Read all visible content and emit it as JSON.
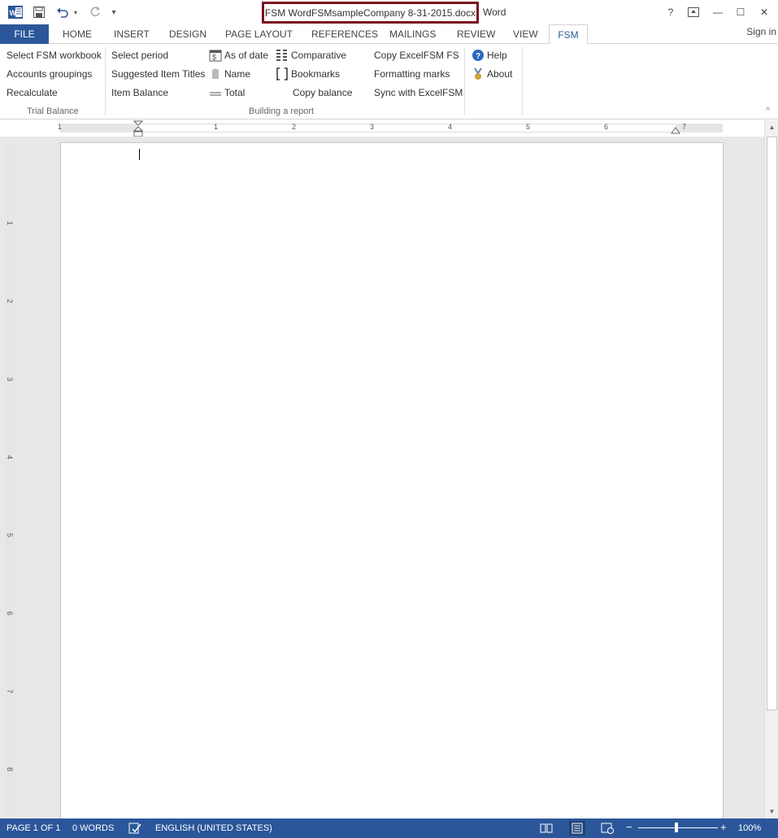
{
  "titlebar": {
    "document_name": "FSM WordFSMsampleCompany 8-31-2015.docx",
    "app_name": "Word",
    "help_glyph": "?",
    "restore_ribbon_glyph": "⇱",
    "minimize_glyph": "—",
    "maximize_glyph": "☐",
    "close_glyph": "✕",
    "customize_glyph": "▾"
  },
  "tabs": [
    {
      "label": "FILE"
    },
    {
      "label": "HOME"
    },
    {
      "label": "INSERT"
    },
    {
      "label": "DESIGN"
    },
    {
      "label": "PAGE LAYOUT"
    },
    {
      "label": "REFERENCES"
    },
    {
      "label": "MAILINGS"
    },
    {
      "label": "REVIEW"
    },
    {
      "label": "VIEW"
    },
    {
      "label": "FSM"
    }
  ],
  "signin": "Sign in",
  "ribbon": {
    "trial_balance": {
      "label": "Trial Balance",
      "select_workbook": "Select FSM workbook",
      "accounts_groupings": "Accounts groupings",
      "recalculate": "Recalculate"
    },
    "building_report": {
      "label": "Building a report",
      "select_period": "Select period",
      "suggested_titles": "Suggested Item Titles",
      "item_balance": "Item Balance",
      "as_of_date": "As of date",
      "name": "Name",
      "total": "Total",
      "comparative": "Comparative",
      "bookmarks": "Bookmarks",
      "copy_balance": "Copy balance",
      "copy_excel_fs": "Copy ExcelFSM FS",
      "formatting_marks": "Formatting marks",
      "sync_excel": "Sync with ExcelFSM"
    },
    "help": "Help",
    "about": "About",
    "collapse_glyph": "^"
  },
  "ruler": {
    "h_labels": [
      "1",
      "1",
      "2",
      "3",
      "4",
      "5",
      "6",
      "7"
    ],
    "v_labels": [
      "1",
      "2",
      "3",
      "4",
      "5",
      "6",
      "7",
      "8"
    ]
  },
  "scrollbar": {
    "up": "▲",
    "down": "▼"
  },
  "status": {
    "page": "PAGE 1 OF 1",
    "words": "0 WORDS",
    "language": "ENGLISH (UNITED STATES)",
    "zoom_minus": "−",
    "zoom_plus": "+",
    "zoom": "100%",
    "zoom_level": 100
  }
}
